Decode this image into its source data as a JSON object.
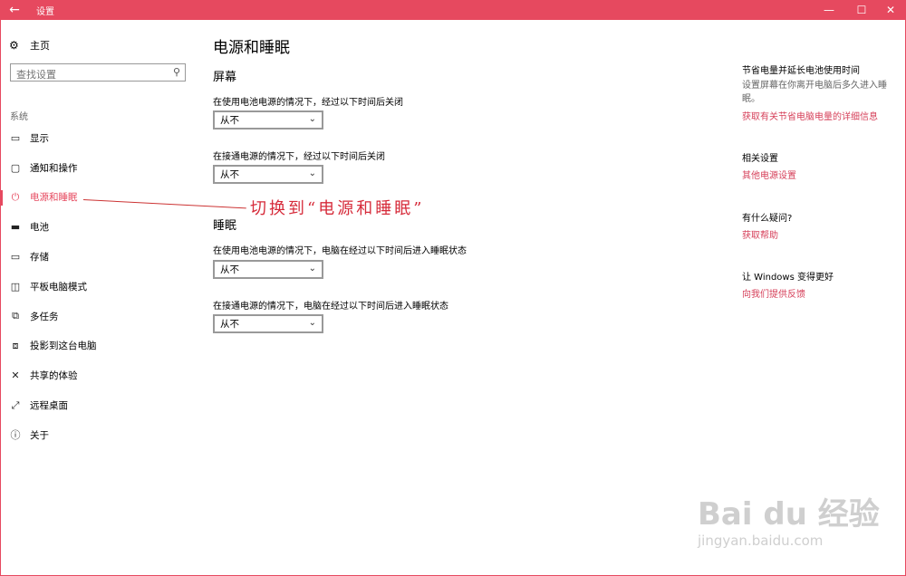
{
  "window": {
    "title": "设置",
    "back_icon": "arrow-left-icon",
    "min_glyph": "—",
    "max_glyph": "☐",
    "close_glyph": "✕"
  },
  "sidebar": {
    "home_label": "主页",
    "search_placeholder": "查找设置",
    "section_label": "系统",
    "items": [
      {
        "label": "显示",
        "icon": "monitor-icon"
      },
      {
        "label": "通知和操作",
        "icon": "message-icon"
      },
      {
        "label": "电源和睡眠",
        "icon": "power-icon"
      },
      {
        "label": "电池",
        "icon": "battery-icon"
      },
      {
        "label": "存储",
        "icon": "storage-icon"
      },
      {
        "label": "平板电脑模式",
        "icon": "tablet-icon"
      },
      {
        "label": "多任务",
        "icon": "multitask-icon"
      },
      {
        "label": "投影到这台电脑",
        "icon": "project-icon"
      },
      {
        "label": "共享的体验",
        "icon": "share-icon"
      },
      {
        "label": "远程桌面",
        "icon": "remote-icon"
      },
      {
        "label": "关于",
        "icon": "info-icon"
      }
    ]
  },
  "main": {
    "title": "电源和睡眠",
    "screen": {
      "heading": "屏幕",
      "battery_label": "在使用电池电源的情况下，经过以下时间后关闭",
      "battery_value": "从不",
      "plugged_label": "在接通电源的情况下，经过以下时间后关闭",
      "plugged_value": "从不"
    },
    "sleep": {
      "heading": "睡眠",
      "battery_label": "在使用电池电源的情况下，电脑在经过以下时间后进入睡眠状态",
      "battery_value": "从不",
      "plugged_label": "在接通电源的情况下，电脑在经过以下时间后进入睡眠状态",
      "plugged_value": "从不"
    }
  },
  "right": {
    "save_heading": "节省电量并延长电池使用时间",
    "save_text": "设置屏幕在你离开电脑后多久进入睡眠。",
    "save_link": "获取有关节省电脑电量的详细信息",
    "related_heading": "相关设置",
    "related_link": "其他电源设置",
    "question_heading": "有什么疑问?",
    "question_link": "获取帮助",
    "better_heading": "让 Windows 变得更好",
    "better_link": "向我们提供反馈"
  },
  "annotation": {
    "text": "切换到“电源和睡眠”"
  },
  "watermark": {
    "big": "Bai du 经验",
    "small": "jingyan.baidu.com"
  },
  "colors": {
    "accent": "#e6495f",
    "link": "#d6405a",
    "annotation": "#d62b3a"
  }
}
